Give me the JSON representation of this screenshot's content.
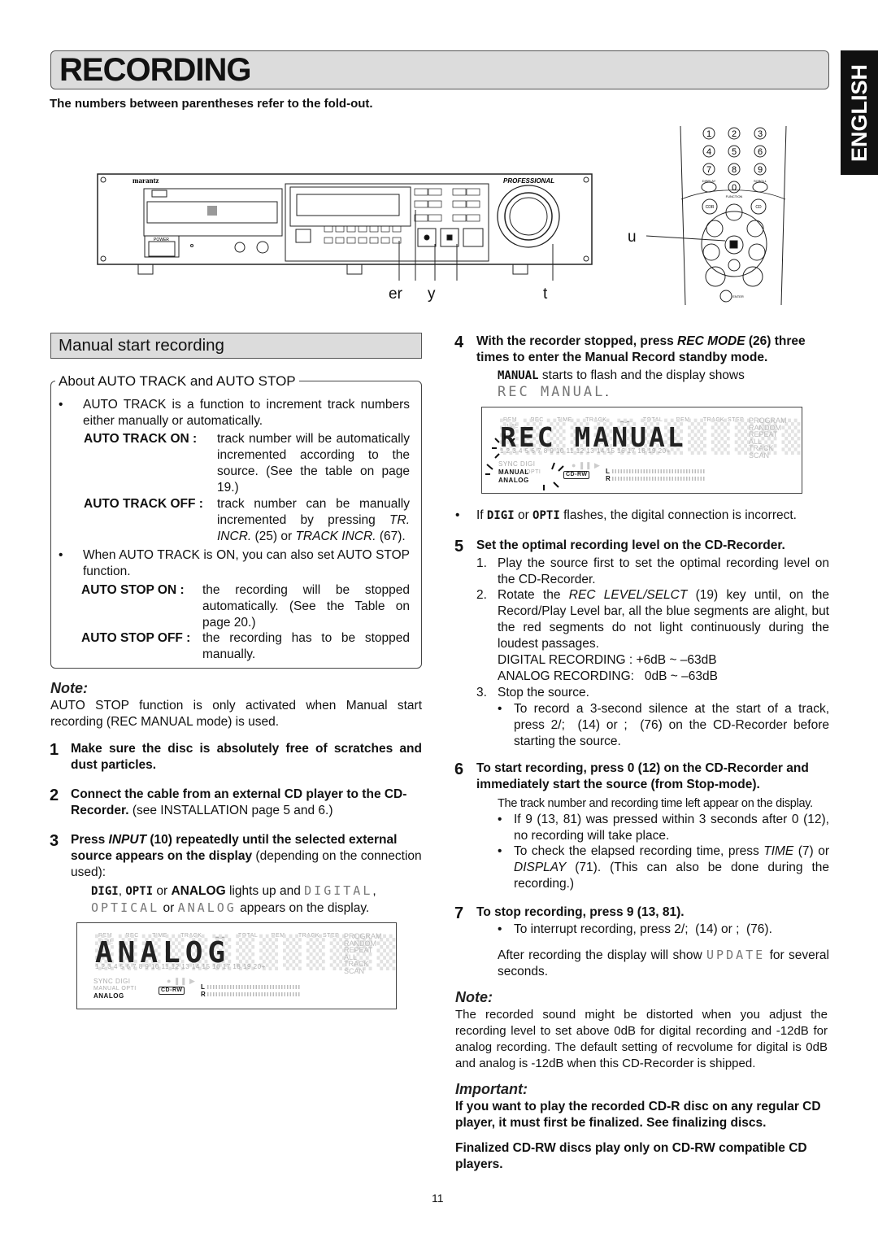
{
  "header": {
    "title": "RECORDING",
    "language_tab": "ENGLISH",
    "subtitle": "The numbers between parentheses refer to the fold-out."
  },
  "illustration": {
    "brand": "marantz",
    "badge": "PROFESSIONAL",
    "power_label": "POWER",
    "callouts": {
      "a": "er",
      "b": "y",
      "c": "t",
      "d": "u"
    },
    "remote_keys": [
      "1",
      "2",
      "3",
      "4",
      "5",
      "6",
      "7",
      "8",
      "9",
      "0"
    ],
    "remote_labels": {
      "function": "FUNCTION",
      "cdr": "CDR",
      "cd": "CD",
      "display": "DISPLAY",
      "scroll": "SCROLL",
      "enter": "ENTER"
    }
  },
  "left": {
    "section_title": "Manual start recording",
    "about_title": "About AUTO TRACK and AUTO STOP",
    "bullet1": "AUTO TRACK is a function to increment track numbers either manually or automatically.",
    "defs1": [
      {
        "key": "AUTO TRACK ON  :",
        "value_pre": "track number will be automatically incremented according to the source. (See the table on page 19.)"
      },
      {
        "key": "AUTO TRACK OFF :",
        "value_pre": "track number can be manually incremented by pressing ",
        "value_it1": "TR. INCR.",
        "value_mid": " (25) or ",
        "value_it2": "TRACK INCR.",
        "value_post": " (67)."
      }
    ],
    "bullet2": "When AUTO TRACK is ON, you can also set AUTO STOP function.",
    "defs2": [
      {
        "key": "AUTO STOP ON  :",
        "value": "the recording will be stopped automatically. (See the Table on page 20.)"
      },
      {
        "key": "AUTO STOP OFF :",
        "value": "the recording has to be stopped manually."
      }
    ],
    "note_title": "Note:",
    "note_text": "AUTO STOP function is only activated when Manual start recording (REC MANUAL mode) is used.",
    "steps": [
      {
        "num": "1",
        "bold": "Make sure the disc is absolutely free of scratches and dust particles."
      },
      {
        "num": "2",
        "bold": "Connect the cable from an external CD player to the CD-Recorder.",
        "normal": " (see INSTALLATION page 5 and 6.)"
      },
      {
        "num": "3",
        "bold_a": "Press ",
        "italic": "INPUT",
        "bold_b": " (10) repeatedly until the selected external source appears on the display",
        "normal": " (depending on the connection used):"
      }
    ],
    "step3_detail": {
      "digi": "DIGI",
      "sep1": ", ",
      "opti": "OPTI",
      "or1": " or ",
      "analog": "ANALOG",
      "mid": " lights up and ",
      "lcd_digital": "DIGITAL",
      "comma": ", ",
      "lcd_optical": "OPTICAL",
      "or2": " or ",
      "lcd_analog": "ANALOG",
      "end": " appears on the display."
    },
    "display": {
      "text": "ANALOG",
      "top_labels": [
        "REM",
        "REC",
        "TIME",
        "TRACK",
        "",
        "TOTAL",
        "REM",
        "TRACK",
        "TIME",
        "STEP"
      ],
      "track_numbers": "1  2  3  4  5 6 7  8  9  10  11  12  13  14 15  16  17 18  19  20+",
      "side_labels": [
        "PROGRAM",
        "RANDOM",
        "REPEAT",
        "ALL",
        "TRACK",
        "SCAN"
      ],
      "sync": "SYNC",
      "digi": "DIGI",
      "manual": "MANUAL",
      "opti": "OPTI",
      "analog": "ANALOG",
      "cdrw": "CD-RW",
      "l": "L",
      "r": "R",
      "transport": "● ❚❚ ▶"
    }
  },
  "right": {
    "step4": {
      "num": "4",
      "bold_a": "With the recorder stopped, press ",
      "italic": "REC MODE",
      "bold_b": " (26) three times to enter the Manual Record standby mode.",
      "manual": "MANUAL",
      "text": " starts to flash and the display shows ",
      "lcd": "REC MANUAL",
      "end": "."
    },
    "display": {
      "text": "REC MANUAL",
      "top_labels": [
        "REM",
        "REC",
        "TIME",
        "TRACK",
        "",
        "TOTAL",
        "REM",
        "TRACK",
        "TIME",
        "STEP"
      ],
      "track_numbers": "1  2  3  4  5 6 7  8  9  10  11  12  13  14 15  16  17 18  19  20+",
      "side_labels": [
        "PROGRAM",
        "RANDOM",
        "REPEAT",
        "ALL",
        "TRACK",
        "SCAN"
      ],
      "sync": "SYNC",
      "digi": "DIGI",
      "manual": "MANUAL",
      "opti": "OPTI",
      "analog": "ANALOG",
      "cdrw": "CD-RW",
      "l": "L",
      "r": "R",
      "transport": "● ❚❚ ▶"
    },
    "bullet4": {
      "pre": "If ",
      "digi": "DIGI",
      "or": " or ",
      "opti": "OPTI",
      "post": " flashes, the digital connection is incorrect."
    },
    "step5": {
      "num": "5",
      "bold": "Set the optimal recording level on the CD-Recorder.",
      "items": [
        {
          "n": "1.",
          "text": "Play the source first to set the optimal recording level on the CD-Recorder."
        },
        {
          "n": "2.",
          "pre": "Rotate the ",
          "it": "REC LEVEL/SELCT",
          "post": " (19) key until, on the Record/Play Level bar, all the blue segments are alight, but the red segments do not light continuously during the loudest passages."
        },
        {
          "n": "3.",
          "text": "Stop the source."
        }
      ],
      "digital_range": "DIGITAL RECORDING : +6dB ~ –63dB",
      "analog_range": "ANALOG RECORDING:   0dB ~ –63dB",
      "bullet": "To record a 3-second silence at the start of a track, press 2/;  (14) or ;  (76) on the CD-Recorder before starting the source."
    },
    "step6": {
      "num": "6",
      "bold": "To start recording, press 0 (12) on the CD-Recorder and immediately start the source (from Stop-mode).",
      "text": "The track number and recording time left appear on the display.",
      "bullet1": "If 9 (13, 81) was pressed within 3 seconds after 0 (12), no recording will take place.",
      "bullet2_pre": "To check the elapsed recording time, press ",
      "bullet2_it1": "TIME",
      "bullet2_mid": " (7) or ",
      "bullet2_it2": "DISPLAY",
      "bullet2_post": "  (71). (This can also be done during the recording.)"
    },
    "step7": {
      "num": "7",
      "bold": "To stop recording, press 9 (13, 81).",
      "bullet": "To interrupt recording, press 2/;  (14) or ;  (76).",
      "after_pre": "After recording the display will show ",
      "lcd": "UPDATE",
      "after_post": " for several seconds."
    },
    "note_title": "Note:",
    "note_text": "The recorded sound might be distorted when you adjust the recording level to set above 0dB for digital recording and -12dB for analog recording. The default setting of recvolume for digital is 0dB and analog is -12dB when this CD-Recorder is shipped.",
    "important_title": "Important:",
    "important_1": "If you want to play the recorded CD-R disc on any regular CD player, it must first be finalized. See finalizing discs.",
    "important_2": "Finalized CD-RW discs play only on CD-RW compatible CD players."
  },
  "page_number": "11"
}
